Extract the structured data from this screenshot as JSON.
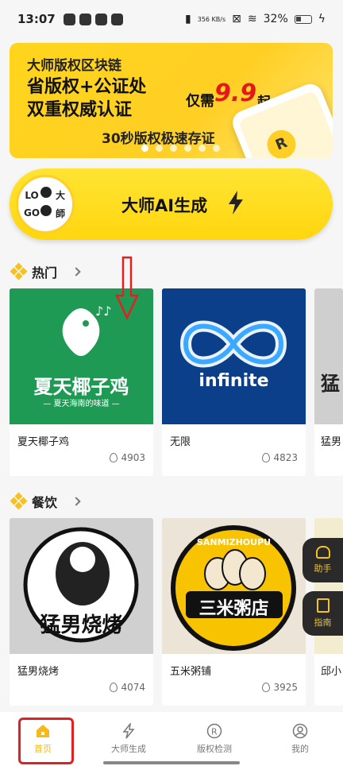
{
  "status_bar": {
    "time": "13:07",
    "net_speed": "356\nKB/s",
    "battery": "32%"
  },
  "banner": {
    "line1": "大师版权区块链",
    "line2": "省版权+公证处",
    "line3": "双重权威认证",
    "price_prefix": "仅需",
    "price": "9.9",
    "price_suffix": "起",
    "subtitle": "30秒版权极速存证",
    "badge": "R"
  },
  "ai_button": {
    "label": "大师AI生成",
    "logo_letters": [
      "LO",
      "大",
      "GO",
      "師"
    ]
  },
  "sections": [
    {
      "title": "热门",
      "cards": [
        {
          "name": "夏天椰子鸡",
          "count": "4903",
          "img_text": "夏天椰子鸡",
          "img_sub": "— 夏天海南的味道 —"
        },
        {
          "name": "无限",
          "count": "4823",
          "img_text": "infinite"
        },
        {
          "name": "猛男",
          "count": "",
          "img_text": "猛"
        }
      ]
    },
    {
      "title": "餐饮",
      "cards": [
        {
          "name": "猛男烧烤",
          "count": "4074",
          "img_text": "猛男烧烤"
        },
        {
          "name": "五米粥铺",
          "count": "3925",
          "img_text": "三米粥店",
          "img_sub": "SANMIZHOUPU"
        },
        {
          "name": "邱小",
          "count": "",
          "img_text": ""
        }
      ]
    }
  ],
  "float_buttons": [
    {
      "label": "助手"
    },
    {
      "label": "指南"
    }
  ],
  "tabs": [
    {
      "label": "首页",
      "active": true
    },
    {
      "label": "大师生成",
      "active": false
    },
    {
      "label": "版权检测",
      "active": false
    },
    {
      "label": "我的",
      "active": false
    }
  ],
  "colors": {
    "accent": "#f7c21d",
    "annotation": "#e02121"
  }
}
